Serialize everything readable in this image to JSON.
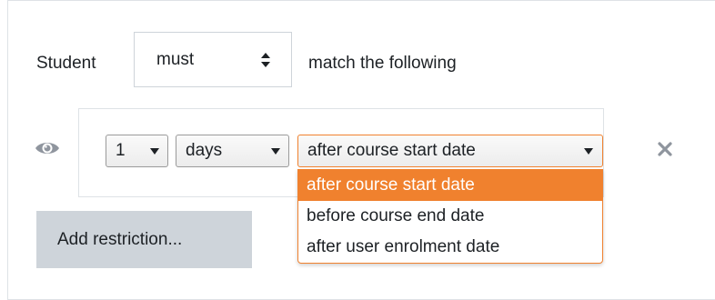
{
  "rule": {
    "student_label": "Student",
    "must_value": "must",
    "match_label": "match the following"
  },
  "condition": {
    "amount_value": "1",
    "unit_value": "days",
    "relative_value": "after course start date",
    "relative_options": [
      "after course start date",
      "before course end date",
      "after user enrolment date"
    ],
    "selected_index": 0
  },
  "actions": {
    "add_restriction_label": "Add restriction..."
  },
  "icons": {
    "visibility": "eye-icon",
    "delete": "close-icon",
    "select_arrows": "updown-arrows-icon",
    "select_caret": "caret-down-icon"
  },
  "colors": {
    "highlight": "#f0812e",
    "button_bg": "#ced4da",
    "text": "#1d2125",
    "icon_gray": "#8f959e"
  }
}
